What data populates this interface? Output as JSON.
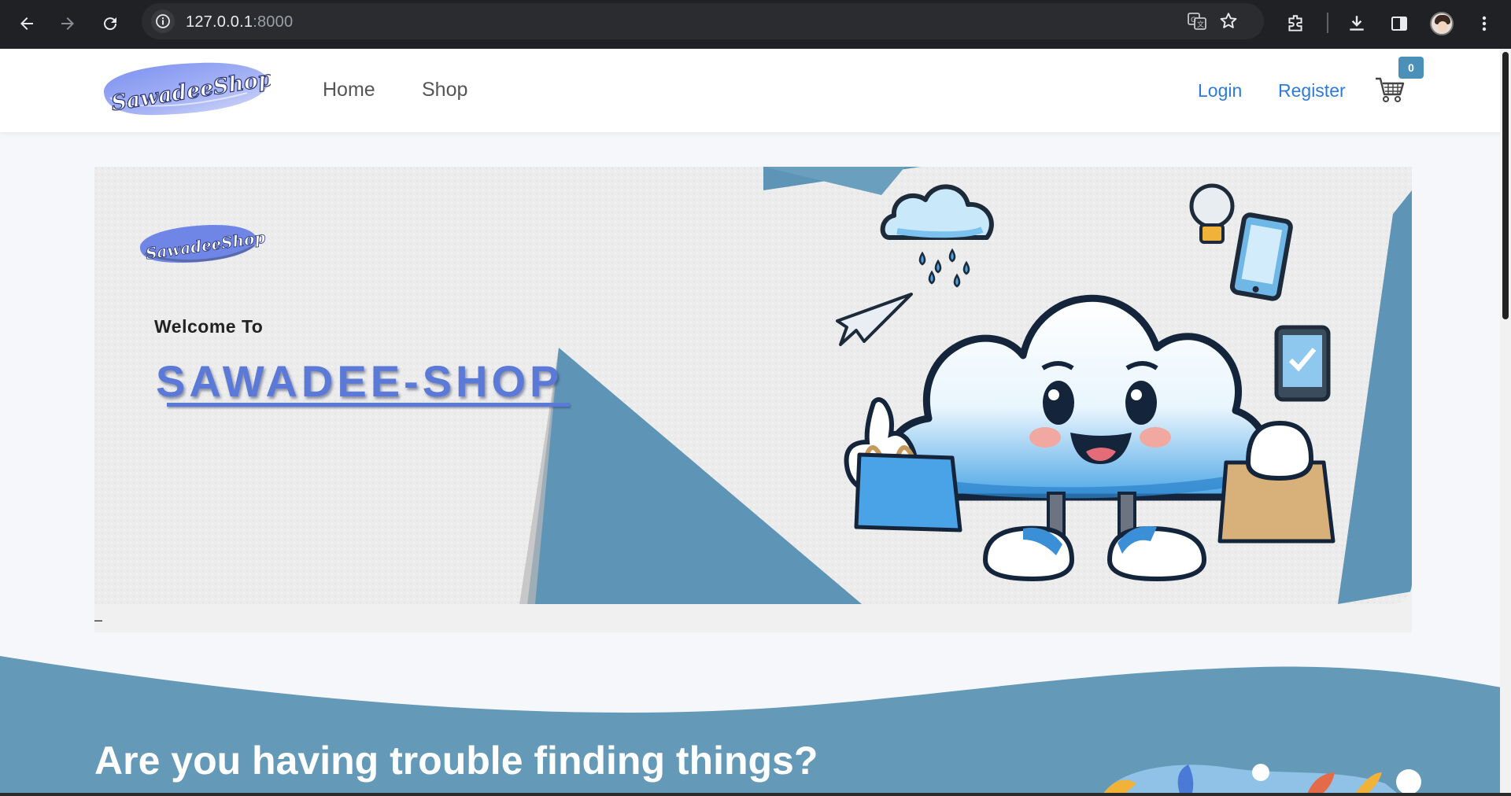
{
  "browser": {
    "url_host": "127.0.0.1",
    "url_port": ":8000",
    "icons": [
      "back-icon",
      "forward-icon",
      "reload-icon",
      "site-info-icon",
      "translate-icon",
      "bookmark-star-icon",
      "extensions-icon",
      "download-icon",
      "side-panel-icon",
      "profile-avatar",
      "menu-icon"
    ]
  },
  "header": {
    "logo_text": "SawadeeShop",
    "nav": [
      {
        "label": "Home"
      },
      {
        "label": "Shop"
      }
    ],
    "login_label": "Login",
    "register_label": "Register",
    "cart_count": "0"
  },
  "banner": {
    "logo_text": "SawadeeShop",
    "welcome": "Welcome To",
    "brand": "SAWADEE-SHOP",
    "dash": "–"
  },
  "section": {
    "title": "Are you having trouble finding things?"
  },
  "colors": {
    "accent_blue": "#2d7bd8",
    "brand_blue": "#5b79d6",
    "wave_blue": "#6599b8",
    "badge_blue": "#4a90b8"
  }
}
